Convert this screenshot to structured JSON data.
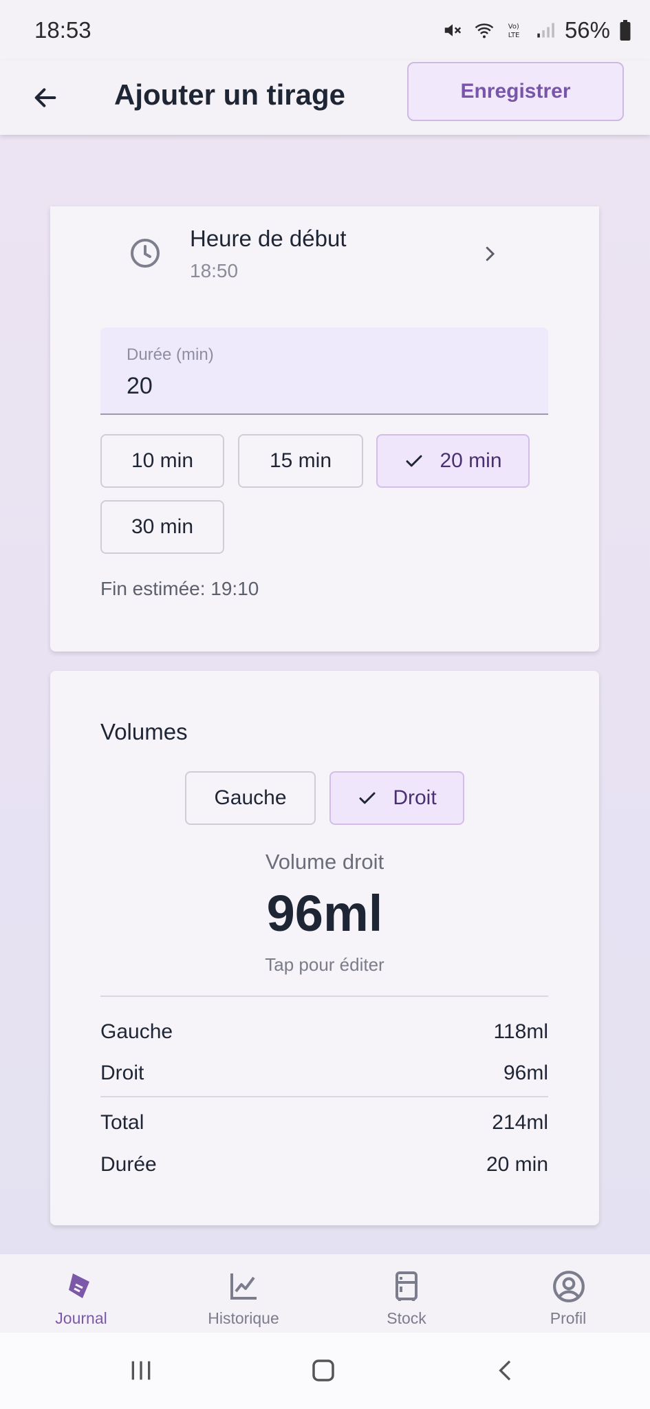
{
  "status_bar": {
    "time": "18:53",
    "battery": "56%"
  },
  "app_bar": {
    "title": "Ajouter un tirage",
    "save_label": "Enregistrer"
  },
  "start": {
    "label": "Heure de début",
    "value": "18:50"
  },
  "duration": {
    "label": "Durée (min)",
    "value": "20",
    "chips": [
      "10 min",
      "15 min",
      "20 min",
      "30 min"
    ],
    "selected": "20 min",
    "end_estimate": "Fin estimée: 19:10"
  },
  "volumes": {
    "title": "Volumes",
    "sides": [
      "Gauche",
      "Droit"
    ],
    "selected_side": "Droit",
    "current_label": "Volume droit",
    "current_value": "96ml",
    "hint": "Tap pour éditer",
    "summary": [
      {
        "label": "Gauche",
        "value": "118ml"
      },
      {
        "label": "Droit",
        "value": "96ml"
      },
      {
        "label": "Total",
        "value": "214ml"
      },
      {
        "label": "Durée",
        "value": "20 min"
      }
    ]
  },
  "bottom_nav": {
    "items": [
      "Journal",
      "Historique",
      "Stock",
      "Profil"
    ],
    "active": "Journal"
  },
  "colors": {
    "accent": "#7c58a8",
    "chip_selected_bg": "#f0e6fb"
  }
}
